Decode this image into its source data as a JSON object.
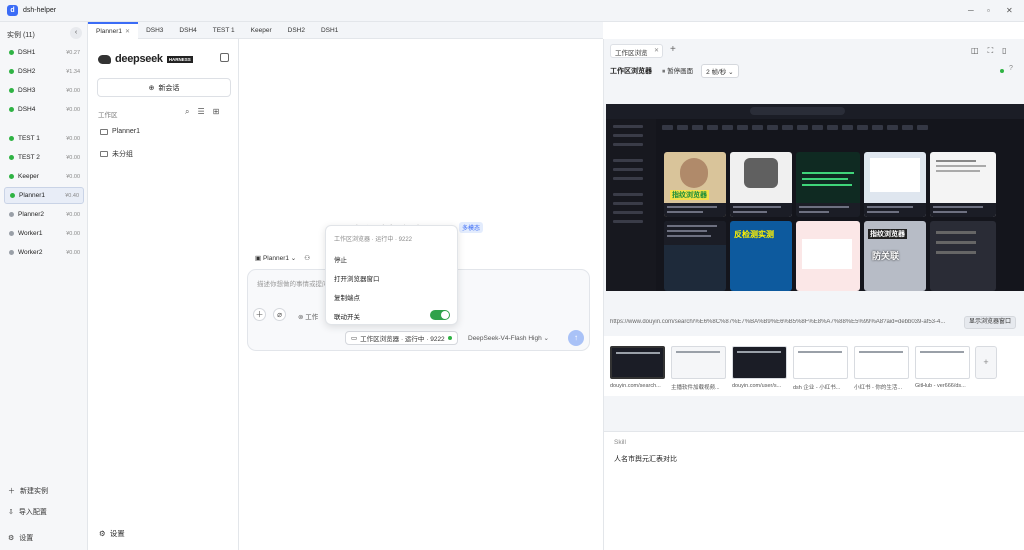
{
  "app": {
    "title": "dsh-helper"
  },
  "sidebar": {
    "header": "实例 (11)",
    "collapse_glyph": "‹",
    "instances": [
      {
        "name": "DSH1",
        "value": "¥0.27",
        "color": "#2fb344"
      },
      {
        "name": "DSH2",
        "value": "¥1.34",
        "color": "#2fb344"
      },
      {
        "name": "DSH3",
        "value": "¥0.00",
        "color": "#2fb344"
      },
      {
        "name": "DSH4",
        "value": "¥0.00",
        "color": "#2fb344"
      },
      {
        "name": "TEST 1",
        "value": "¥0.00",
        "color": "#2fb344"
      },
      {
        "name": "TEST 2",
        "value": "¥0.00",
        "color": "#2fb344"
      },
      {
        "name": "Keeper",
        "value": "¥0.00",
        "color": "#2fb344"
      },
      {
        "name": "Planner1",
        "value": "¥0.40",
        "color": "#2fb344"
      },
      {
        "name": "Planner2",
        "value": "¥0.00",
        "color": "#9aa0a8"
      },
      {
        "name": "Worker1",
        "value": "¥0.00",
        "color": "#9aa0a8"
      },
      {
        "name": "Worker2",
        "value": "¥0.00",
        "color": "#9aa0a8"
      }
    ],
    "new_instance": "新建实例",
    "import_config": "导入配置",
    "settings": "设置"
  },
  "tabs": [
    {
      "label": "Planner1",
      "active": true
    },
    {
      "label": "DSH3"
    },
    {
      "label": "DSH4"
    },
    {
      "label": "TEST 1"
    },
    {
      "label": "Keeper"
    },
    {
      "label": "DSH2"
    },
    {
      "label": "DSH1"
    }
  ],
  "deepseek": {
    "brand": "deepseek",
    "badge": "HARNESS",
    "new_chat": "新会话",
    "workspace_label": "工作区",
    "folders": [
      "Planner1",
      "未分组"
    ],
    "settings": "设置"
  },
  "chat": {
    "hero": "我们该如何帮",
    "hero_badge": "多模态",
    "chip_project": "Planner1",
    "placeholder": "描述你想做的事情或提问...",
    "attach_label": "工作",
    "browser_chip": "工作区浏览器 · 运行中 · 9222",
    "model": "DeepSeek-V4-Flash",
    "effort": "High"
  },
  "popup": {
    "title": "工作区浏览器 · 运行中 · 9222",
    "items": [
      "停止",
      "打开浏览器窗口",
      "复制端点",
      "联动开关"
    ],
    "toggle_on": true
  },
  "browser": {
    "tab_label": "工作区浏览",
    "toolbar_title": "工作区浏览器",
    "pause_label": "暂停画面",
    "rate": "2 帧/秒",
    "url": "https://www.douyin.com/search/%E6%8C%87%E7%BA%B9%E6%B5%8F%E8%A7%88%E5%99%A8?aid=debb039-af53-4...",
    "show_window_btn": "显示浏览器窗口",
    "thumbnails": [
      {
        "caption": "douyin.com/search...",
        "active": true
      },
      {
        "caption": "主播软件加载视频..."
      },
      {
        "caption": "douyin.com/user/s..."
      },
      {
        "caption": "dsh 企业 - 小红书..."
      },
      {
        "caption": "小红书 - 你的生活..."
      },
      {
        "caption": "GitHub - ver666/ds..."
      }
    ],
    "skill_label": "Skill",
    "skill_text": "人名市舆元汇表对比",
    "overlays": [
      "指纹浏览器",
      "反检测实测",
      "指纹浏览器",
      "防关联"
    ]
  }
}
